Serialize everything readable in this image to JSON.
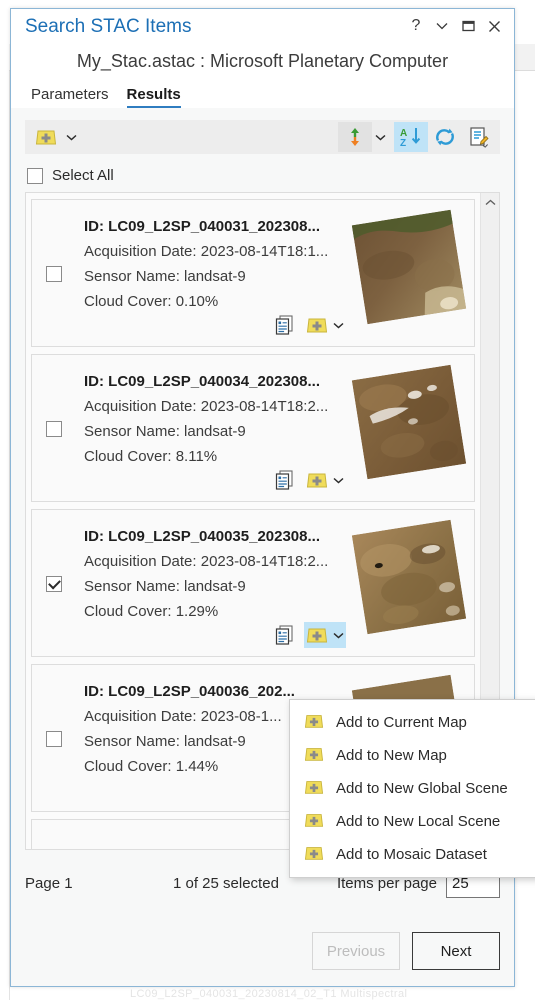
{
  "window": {
    "title": "Search STAC Items",
    "subtitle": "My_Stac.astac : Microsoft Planetary Computer",
    "controls": {
      "help": "?",
      "dropdown": "∨",
      "maximize": "□",
      "close": "×"
    }
  },
  "tabs": [
    {
      "label": "Parameters",
      "active": false
    },
    {
      "label": "Results",
      "active": true
    }
  ],
  "toolbar": {
    "add_to_map_label": "Add To Map",
    "add_caret_label": "Add To Map options",
    "sort_direction_label": "Sort direction",
    "sort_direction_caret_label": "Sort direction options",
    "sort_az_label": "Sort A to Z",
    "refresh_label": "Refresh",
    "edit_label": "Edit metadata"
  },
  "select_all": {
    "label": "Select All",
    "checked": false
  },
  "results": [
    {
      "id": "ID: LC09_L2SP_040031_202308...",
      "acquisition_date": "Acquisition Date: 2023-08-14T18:1...",
      "sensor_name": "Sensor Name: landsat-9",
      "cloud_cover": "Cloud Cover: 0.10%",
      "checked": false,
      "menu_open": false,
      "show_add": true
    },
    {
      "id": "ID: LC09_L2SP_040034_202308...",
      "acquisition_date": "Acquisition Date: 2023-08-14T18:2...",
      "sensor_name": "Sensor Name: landsat-9",
      "cloud_cover": "Cloud Cover: 8.11%",
      "checked": false,
      "menu_open": false,
      "show_add": true
    },
    {
      "id": "ID: LC09_L2SP_040035_202308...",
      "acquisition_date": "Acquisition Date: 2023-08-14T18:2...",
      "sensor_name": "Sensor Name: landsat-9",
      "cloud_cover": "Cloud Cover: 1.29%",
      "checked": true,
      "menu_open": true,
      "show_add": true
    },
    {
      "id": "ID: LC09_L2SP_040036_202...",
      "acquisition_date": "Acquisition Date: 2023-08-1...",
      "sensor_name": "Sensor Name: landsat-9",
      "cloud_cover": "Cloud Cover: 1.44%",
      "checked": false,
      "menu_open": false,
      "show_add": false
    }
  ],
  "add_menu": {
    "items": [
      {
        "label": "Add to Current  Map",
        "icon": "add-to-map-icon"
      },
      {
        "label": "Add to New Map",
        "icon": "add-to-map-icon"
      },
      {
        "label": "Add to New Global Scene",
        "icon": "add-to-map-icon"
      },
      {
        "label": "Add to New Local Scene",
        "icon": "add-to-map-icon"
      },
      {
        "label": "Add to Mosaic Dataset",
        "icon": "add-to-map-icon"
      }
    ]
  },
  "footer": {
    "page": "Page 1",
    "selected": "1 of 25 selected",
    "items_per_page_label": "Items per page",
    "items_per_page_value": "25",
    "previous": "Previous",
    "next": "Next",
    "previous_disabled": true
  },
  "background": {
    "bottom_text": "LC09_L2SP_040031_20230814_02_T1 Multispectral"
  },
  "colors": {
    "title": "#1c6fb5",
    "tab_underline": "#2f7dc0",
    "highlight": "#bfe3f7",
    "dialog_border": "#8cb6d6",
    "icon_yellow": "#f0dc5a",
    "icon_blue": "#2e9bd6",
    "accent_orange": "#ef8022",
    "accent_green": "#3a9b35"
  }
}
